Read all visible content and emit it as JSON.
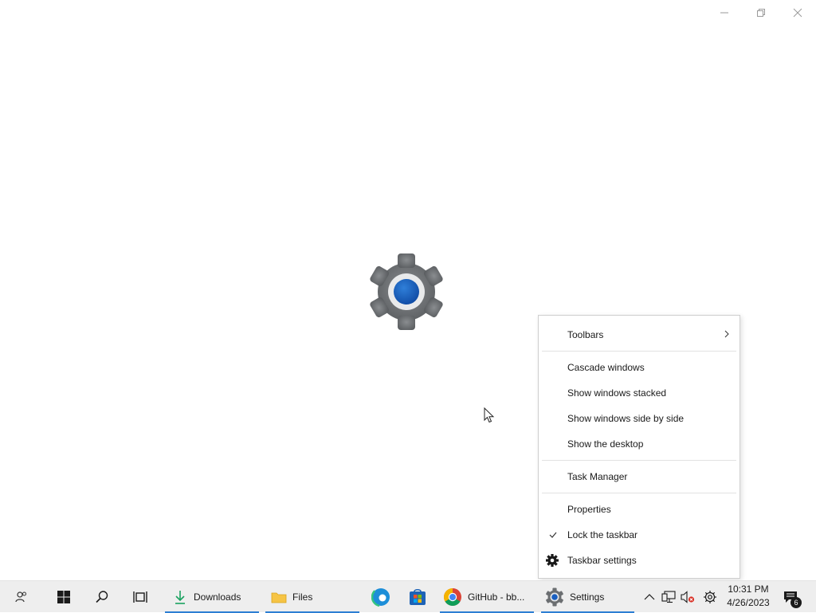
{
  "window": {
    "caption_buttons": [
      {
        "name": "minimize-icon"
      },
      {
        "name": "restore-icon"
      },
      {
        "name": "close-icon"
      }
    ],
    "splash_icon": "settings-gear-icon"
  },
  "context_menu": {
    "items": [
      {
        "label": "Toolbars",
        "has_submenu": true
      },
      {
        "label": "Cascade windows"
      },
      {
        "label": "Show windows stacked"
      },
      {
        "label": "Show windows side by side"
      },
      {
        "label": "Show the desktop"
      },
      {
        "label": "Task Manager"
      },
      {
        "label": "Properties"
      },
      {
        "label": "Lock the taskbar",
        "checked": true
      },
      {
        "label": "Taskbar settings",
        "icon": "gear-icon"
      }
    ]
  },
  "taskbar": {
    "pinned_icons": [
      "people-icon",
      "windows-start-icon",
      "search-icon",
      "task-view-icon"
    ],
    "apps": [
      {
        "label": "Downloads",
        "icon": "download-arrow-icon",
        "active": true
      },
      {
        "label": "Files",
        "icon": "folder-icon",
        "active": true
      },
      {
        "label": "",
        "icon": "edge-icon"
      },
      {
        "label": "",
        "icon": "store-icon"
      },
      {
        "label": "GitHub - bb...",
        "icon": "chrome-icon",
        "active": true
      },
      {
        "label": "Settings",
        "icon": "settings-gear-icon",
        "active": true
      }
    ],
    "tray_icons": [
      "chevron-up-icon",
      "network-icon",
      "volume-muted-icon",
      "settings-gear-icon"
    ],
    "clock": {
      "time": "10:31 PM",
      "date": "4/26/2023"
    },
    "notifications": {
      "icon": "action-center-icon",
      "count": "6"
    },
    "accent_color": "#2d7fd3"
  }
}
